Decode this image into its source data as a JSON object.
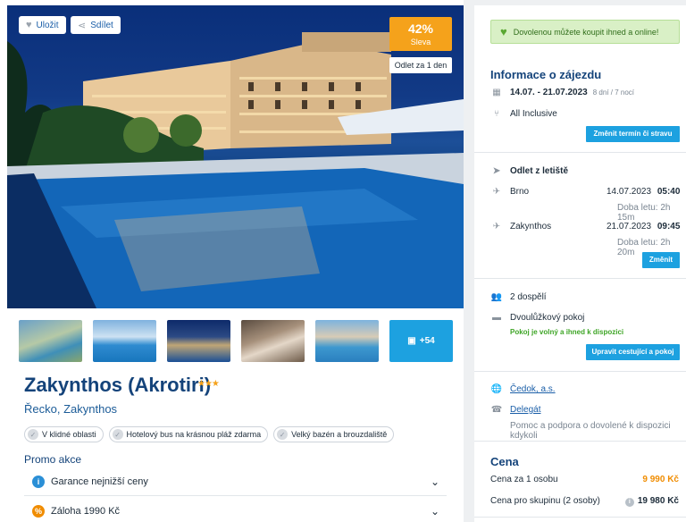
{
  "gallery": {
    "save_label": "Uložit",
    "share_label": "Sdílet",
    "discount_pct": "42%",
    "discount_label": "Sleva",
    "departure_badge": "Odlet za 1 den",
    "more_count": "+54"
  },
  "hotel": {
    "name": "Zakynthos (Akrotiri)",
    "stars": "★★★",
    "location": "Řecko, Zakynthos",
    "tags": [
      "V klidné oblasti",
      "Hotelový bus na krásnou pláž zdarma",
      "Velký bazén a brouzdaliště"
    ]
  },
  "promo": {
    "title": "Promo akce",
    "items": [
      {
        "icon": "info-icon",
        "text": "Garance nejnižší ceny",
        "color": "#2b8fd6"
      },
      {
        "icon": "percent-icon",
        "text": "Záloha 1990 Kč",
        "color": "#f08c00"
      }
    ]
  },
  "sidebar": {
    "banner": "Dovolenou můžete koupit ihned a online!",
    "info_title": "Informace o zájezdu",
    "dates": "14.07. - 21.07.2023",
    "duration": "8 dní / 7 nocí",
    "board": "All Inclusive",
    "change_term_button": "Změnit termín či stravu",
    "departure_title": "Odlet z letiště",
    "outbound": {
      "city": "Brno",
      "date": "14.07.2023",
      "time": "05:40",
      "duration": "Doba letu: 2h 15m"
    },
    "inbound": {
      "city": "Zakynthos",
      "date": "21.07.2023",
      "time": "09:45",
      "duration": "Doba letu: 2h 20m"
    },
    "change_button": "Změnit",
    "travellers": "2 dospělí",
    "room": "Dvoulůžkový pokoj",
    "room_status": "Pokoj je volný a ihned k dispozici",
    "edit_travellers_button": "Upravit cestující a pokoj",
    "operator": "Čedok, a.s.",
    "delegate": "Delegát",
    "delegate_note": "Pomoc a podpora o dovolené k dispozici kdykoli",
    "price_title": "Cena",
    "price_per_person_label": "Cena za 1 osobu",
    "price_per_person": "9 990 Kč",
    "price_group_label": "Cena pro skupinu (2 osoby)",
    "price_group": "19 980 Kč"
  },
  "colors": {
    "accent": "#1da1e0",
    "brand": "#14437a",
    "discount": "#f5a21b",
    "success": "#3ea526"
  }
}
